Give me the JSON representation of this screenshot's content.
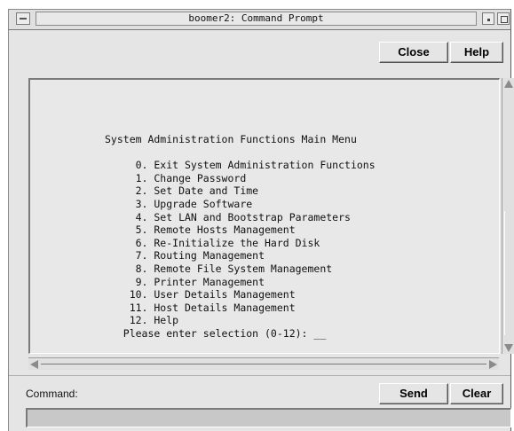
{
  "window": {
    "title": "boomer2: Command Prompt"
  },
  "buttons": {
    "close": "Close",
    "help": "Help",
    "send": "Send",
    "clear": "Clear"
  },
  "terminal": {
    "lines": [
      "System Administration Functions Main Menu",
      "",
      "     0. Exit System Administration Functions",
      "     1. Change Password",
      "     2. Set Date and Time",
      "     3. Upgrade Software",
      "     4. Set LAN and Bootstrap Parameters",
      "     5. Remote Hosts Management",
      "     6. Re-Initialize the Hard Disk",
      "     7. Routing Management",
      "     8. Remote File System Management",
      "     9. Printer Management",
      "    10. User Details Management",
      "    11. Host Details Management",
      "    12. Help",
      "   Please enter selection (0-12): __"
    ]
  },
  "command": {
    "label": "Command:",
    "value": ""
  }
}
